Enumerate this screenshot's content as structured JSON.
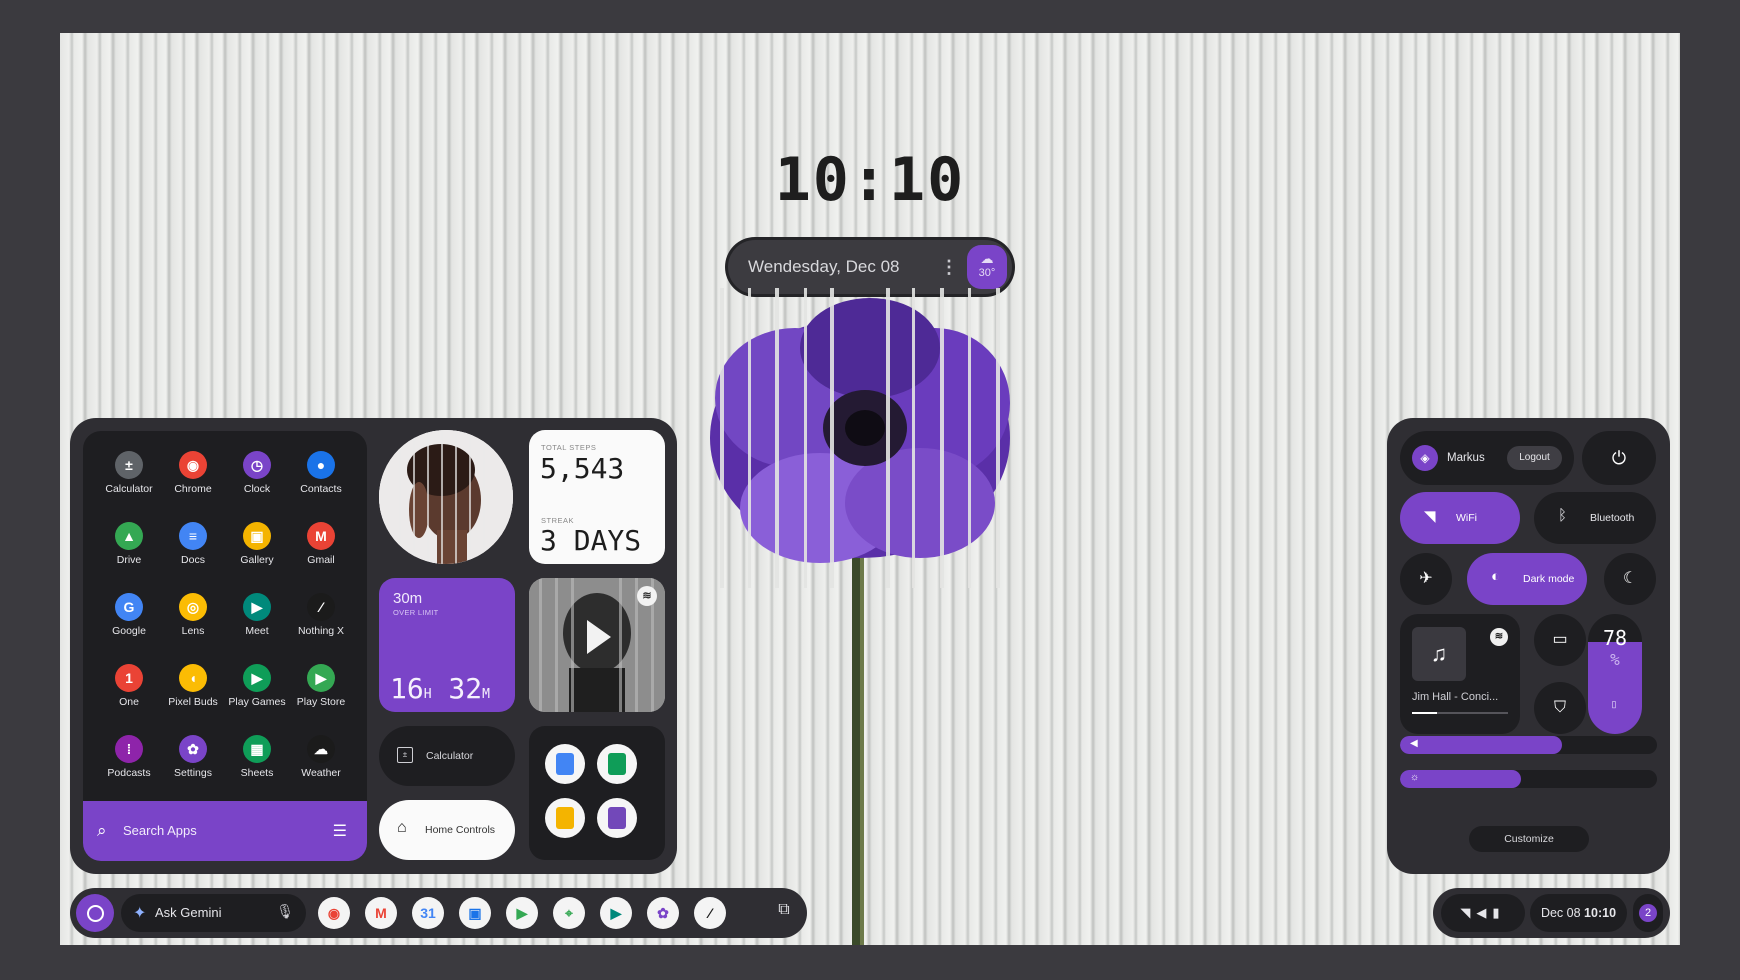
{
  "clock": {
    "time": "10:10"
  },
  "date_widget": {
    "date": "Wendesday, Dec 08",
    "menu_icon": "more-vert-icon",
    "weather_icon": "cloud-sun-icon",
    "temperature": "30°"
  },
  "wallpaper": {
    "subject_icon": "purple-anemone-flower"
  },
  "app_drawer": {
    "apps": [
      {
        "label": "Calculator",
        "icon": "calculator-icon",
        "color": "#5f6368"
      },
      {
        "label": "Chrome",
        "icon": "chrome-icon",
        "color": "#ea4335"
      },
      {
        "label": "Clock",
        "icon": "clock-icon",
        "color": "#7a44c8"
      },
      {
        "label": "Contacts",
        "icon": "contacts-icon",
        "color": "#1a73e8"
      },
      {
        "label": "Drive",
        "icon": "drive-icon",
        "color": "#34a853"
      },
      {
        "label": "Docs",
        "icon": "docs-icon",
        "color": "#4285f4"
      },
      {
        "label": "Gallery",
        "icon": "gallery-icon",
        "color": "#f4b400"
      },
      {
        "label": "Gmail",
        "icon": "gmail-icon",
        "color": "#ea4335"
      },
      {
        "label": "Google",
        "icon": "google-icon",
        "color": "#4285f4"
      },
      {
        "label": "Lens",
        "icon": "lens-icon",
        "color": "#fbbc04"
      },
      {
        "label": "Meet",
        "icon": "meet-icon",
        "color": "#00897b"
      },
      {
        "label": "Nothing X",
        "icon": "nothing-x-icon",
        "color": "#1b1b1b"
      },
      {
        "label": "One",
        "icon": "google-one-icon",
        "color": "#ea4335"
      },
      {
        "label": "Pixel Buds",
        "icon": "pixel-buds-icon",
        "color": "#fbbc04"
      },
      {
        "label": "Play Games",
        "icon": "play-games-icon",
        "color": "#0f9d58"
      },
      {
        "label": "Play Store",
        "icon": "play-store-icon",
        "color": "#34a853"
      },
      {
        "label": "Podcasts",
        "icon": "podcasts-icon",
        "color": "#8e24aa"
      },
      {
        "label": "Settings",
        "icon": "settings-icon",
        "color": "#7a44c8"
      },
      {
        "label": "Sheets",
        "icon": "sheets-icon",
        "color": "#0f9d58"
      },
      {
        "label": "Weather",
        "icon": "weather-icon",
        "color": "#1b1b1b"
      }
    ],
    "search_placeholder": "Search Apps",
    "search_icon": "search-icon",
    "list_icon": "list-view-icon"
  },
  "widgets": {
    "profile_photo": {
      "icon": "portrait-photo"
    },
    "steps": {
      "label": "TOTAL STEPS",
      "value": "5,543",
      "streak_label": "STREAK",
      "streak_value": "3 DAYS"
    },
    "screen_time": {
      "over": "30m",
      "over_label": "OVER LIMIT",
      "hours": "16",
      "hours_unit": "H",
      "minutes": "32",
      "minutes_unit": "M"
    },
    "music_art": {
      "icon": "spotify-icon"
    },
    "calculator_pill": {
      "label": "Calculator",
      "icon": "calculator-icon"
    },
    "home_pill": {
      "label": "Home Controls",
      "icon": "home-icon"
    },
    "office_apps": [
      {
        "icon": "docs-icon",
        "color": "#4285f4"
      },
      {
        "icon": "sheets-icon",
        "color": "#0f9d58"
      },
      {
        "icon": "slides-icon",
        "color": "#f4b400"
      },
      {
        "icon": "forms-icon",
        "color": "#7248b9"
      }
    ]
  },
  "quick_settings": {
    "user": {
      "name": "Markus",
      "logout": "Logout",
      "avatar_icon": "user-avatar-icon"
    },
    "power_icon": "power-icon",
    "wifi": {
      "label": "WiFi",
      "icon": "wifi-icon",
      "on": true
    },
    "bluetooth": {
      "label": "Bluetooth",
      "icon": "bluetooth-icon",
      "on": false
    },
    "airplane_icon": "airplane-icon",
    "dark_mode": {
      "label": "Dark mode",
      "icon": "dark-mode-icon",
      "on": true
    },
    "night_icon": "moon-icon",
    "media": {
      "title": "Jim Hall - Conci...",
      "art_icon": "music-note-icon",
      "source_icon": "spotify-icon",
      "progress": 0.26
    },
    "camera_icon": "video-camera-icon",
    "security_icon": "shield-check-icon",
    "battery": {
      "level": "78",
      "unit": "%",
      "fraction": 0.78,
      "icon": "battery-saver-icon"
    },
    "volume": {
      "icon": "volume-icon",
      "level": 0.63
    },
    "brightness": {
      "icon": "brightness-icon",
      "level": 0.47
    },
    "customize": "Customize"
  },
  "taskbar": {
    "launcher_icon": "launcher-circle-icon",
    "ask_label": "Ask Gemini",
    "gemini_icon": "gemini-sparkle-icon",
    "mic_icon": "microphone-icon",
    "pinned": [
      {
        "icon": "chrome-icon",
        "color": "#ea4335"
      },
      {
        "icon": "gmail-icon",
        "color": "#ea4335"
      },
      {
        "icon": "calendar-icon",
        "color": "#4285f4"
      },
      {
        "icon": "gallery-icon",
        "color": "#1a73e8"
      },
      {
        "icon": "play-store-icon",
        "color": "#34a853"
      },
      {
        "icon": "maps-icon",
        "color": "#34a853"
      },
      {
        "icon": "meet-icon",
        "color": "#00897b"
      },
      {
        "icon": "settings-icon",
        "color": "#7a44c8"
      },
      {
        "icon": "nothing-x-icon",
        "color": "#1b1b1b"
      }
    ],
    "overview_icon": "overview-windows-icon"
  },
  "system_tray": {
    "wifi_icon": "wifi-icon",
    "volume_icon": "volume-icon",
    "battery_icon": "battery-icon",
    "date": "Dec 08",
    "time": "10:10",
    "notification_count": "2"
  }
}
